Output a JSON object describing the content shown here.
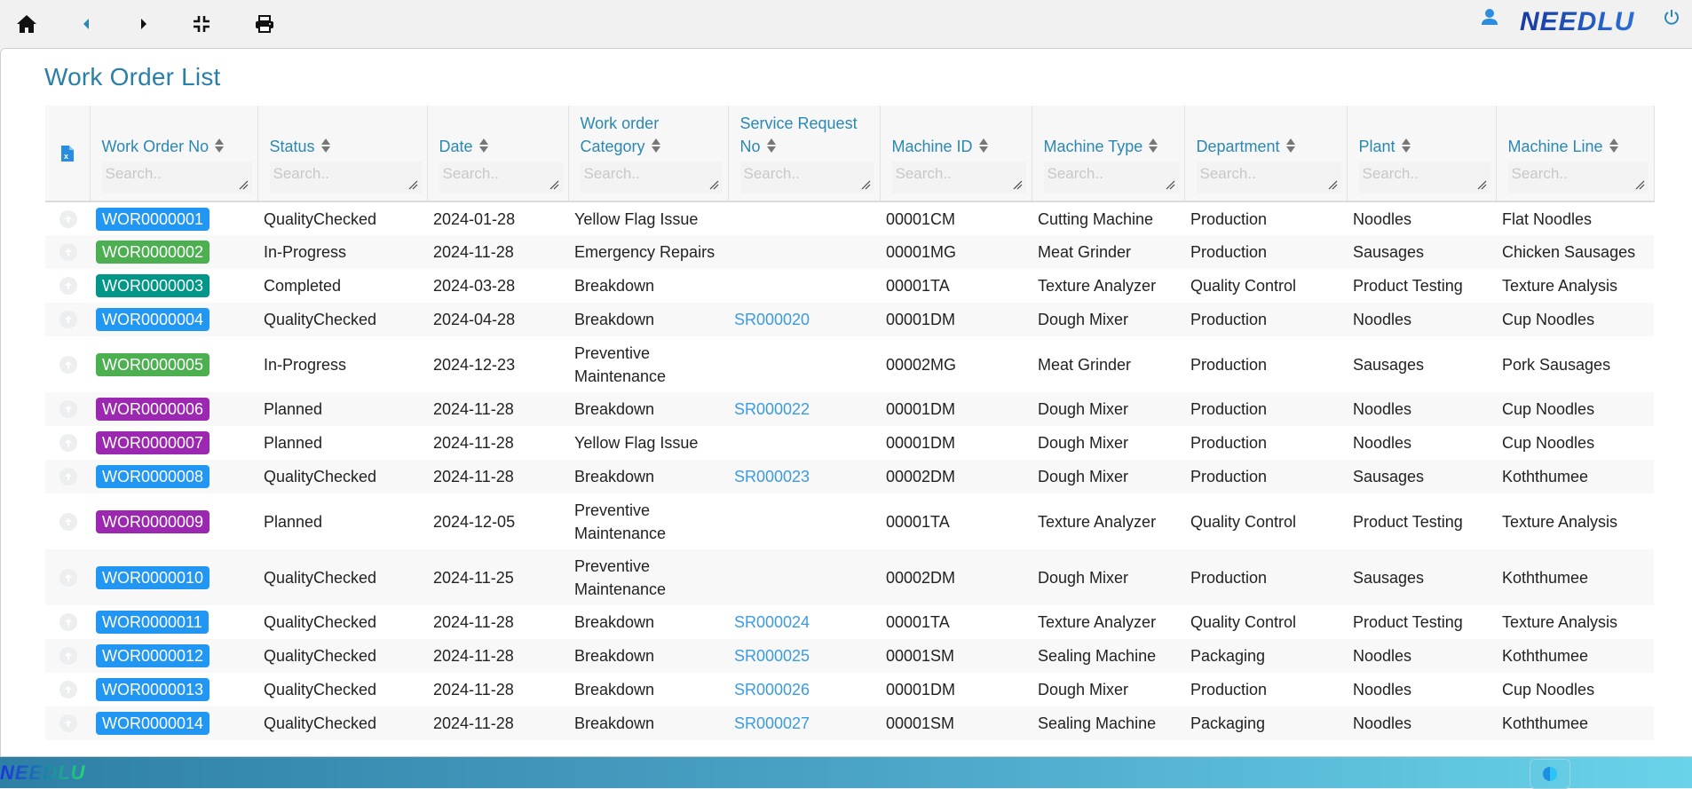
{
  "toolbar": {
    "icons": [
      "home-icon",
      "back-icon",
      "forward-icon",
      "collapse-icon",
      "print-icon"
    ],
    "brand": "NEEDLU",
    "user_icon": "user-icon",
    "power_icon": "power-icon"
  },
  "page": {
    "title": "Work Order List"
  },
  "table": {
    "export_icon": "excel-export-icon",
    "search_placeholder": "Search..",
    "columns": [
      {
        "label": "Work Order No"
      },
      {
        "label": "Status"
      },
      {
        "label": "Date"
      },
      {
        "label": "Work order Category"
      },
      {
        "label": "Service Request No"
      },
      {
        "label": "Machine ID"
      },
      {
        "label": "Machine Type"
      },
      {
        "label": "Department"
      },
      {
        "label": "Plant"
      },
      {
        "label": "Machine Line"
      }
    ],
    "status_colors": {
      "QualityChecked": "#2196f3",
      "In-Progress": "#4caf50",
      "Completed": "#009688",
      "Planned": "#9c27b0"
    },
    "rows": [
      {
        "wo": "WOR0000001",
        "status": "QualityChecked",
        "date": "2024-01-28",
        "category": "Yellow Flag Issue",
        "sr": "",
        "machine_id": "00001CM",
        "machine_type": "Cutting Machine",
        "department": "Production",
        "plant": "Noodles",
        "line": "Flat Noodles"
      },
      {
        "wo": "WOR0000002",
        "status": "In-Progress",
        "date": "2024-11-28",
        "category": "Emergency Repairs",
        "sr": "",
        "machine_id": "00001MG",
        "machine_type": "Meat Grinder",
        "department": "Production",
        "plant": "Sausages",
        "line": "Chicken Sausages"
      },
      {
        "wo": "WOR0000003",
        "status": "Completed",
        "date": "2024-03-28",
        "category": "Breakdown",
        "sr": "",
        "machine_id": "00001TA",
        "machine_type": "Texture Analyzer",
        "department": "Quality Control",
        "plant": "Product Testing",
        "line": "Texture Analysis"
      },
      {
        "wo": "WOR0000004",
        "status": "QualityChecked",
        "date": "2024-04-28",
        "category": "Breakdown",
        "sr": "SR000020",
        "machine_id": "00001DM",
        "machine_type": "Dough Mixer",
        "department": "Production",
        "plant": "Noodles",
        "line": "Cup Noodles"
      },
      {
        "wo": "WOR0000005",
        "status": "In-Progress",
        "date": "2024-12-23",
        "category": "Preventive Maintenance",
        "sr": "",
        "machine_id": "00002MG",
        "machine_type": "Meat Grinder",
        "department": "Production",
        "plant": "Sausages",
        "line": "Pork Sausages"
      },
      {
        "wo": "WOR0000006",
        "status": "Planned",
        "date": "2024-11-28",
        "category": "Breakdown",
        "sr": "SR000022",
        "machine_id": "00001DM",
        "machine_type": "Dough Mixer",
        "department": "Production",
        "plant": "Noodles",
        "line": "Cup Noodles"
      },
      {
        "wo": "WOR0000007",
        "status": "Planned",
        "date": "2024-11-28",
        "category": "Yellow Flag Issue",
        "sr": "",
        "machine_id": "00001DM",
        "machine_type": "Dough Mixer",
        "department": "Production",
        "plant": "Noodles",
        "line": "Cup Noodles"
      },
      {
        "wo": "WOR0000008",
        "status": "QualityChecked",
        "date": "2024-11-28",
        "category": "Breakdown",
        "sr": "SR000023",
        "machine_id": "00002DM",
        "machine_type": "Dough Mixer",
        "department": "Production",
        "plant": "Sausages",
        "line": "Koththumee"
      },
      {
        "wo": "WOR0000009",
        "status": "Planned",
        "date": "2024-12-05",
        "category": "Preventive Maintenance",
        "sr": "",
        "machine_id": "00001TA",
        "machine_type": "Texture Analyzer",
        "department": "Quality Control",
        "plant": "Product Testing",
        "line": "Texture Analysis"
      },
      {
        "wo": "WOR0000010",
        "status": "QualityChecked",
        "date": "2024-11-25",
        "category": "Preventive Maintenance",
        "sr": "",
        "machine_id": "00002DM",
        "machine_type": "Dough Mixer",
        "department": "Production",
        "plant": "Sausages",
        "line": "Koththumee"
      },
      {
        "wo": "WOR0000011",
        "status": "QualityChecked",
        "date": "2024-11-28",
        "category": "Breakdown",
        "sr": "SR000024",
        "machine_id": "00001TA",
        "machine_type": "Texture Analyzer",
        "department": "Quality Control",
        "plant": "Product Testing",
        "line": "Texture Analysis"
      },
      {
        "wo": "WOR0000012",
        "status": "QualityChecked",
        "date": "2024-11-28",
        "category": "Breakdown",
        "sr": "SR000025",
        "machine_id": "00001SM",
        "machine_type": "Sealing Machine",
        "department": "Packaging",
        "plant": "Noodles",
        "line": "Koththumee"
      },
      {
        "wo": "WOR0000013",
        "status": "QualityChecked",
        "date": "2024-11-28",
        "category": "Breakdown",
        "sr": "SR000026",
        "machine_id": "00001DM",
        "machine_type": "Dough Mixer",
        "department": "Production",
        "plant": "Noodles",
        "line": "Cup Noodles"
      },
      {
        "wo": "WOR0000014",
        "status": "QualityChecked",
        "date": "2024-11-28",
        "category": "Breakdown",
        "sr": "SR000027",
        "machine_id": "00001SM",
        "machine_type": "Sealing Machine",
        "department": "Packaging",
        "plant": "Noodles",
        "line": "Koththumee"
      }
    ]
  },
  "footer": {
    "brand": "NEEDLU",
    "theme_toggle_icon": "contrast-icon"
  }
}
